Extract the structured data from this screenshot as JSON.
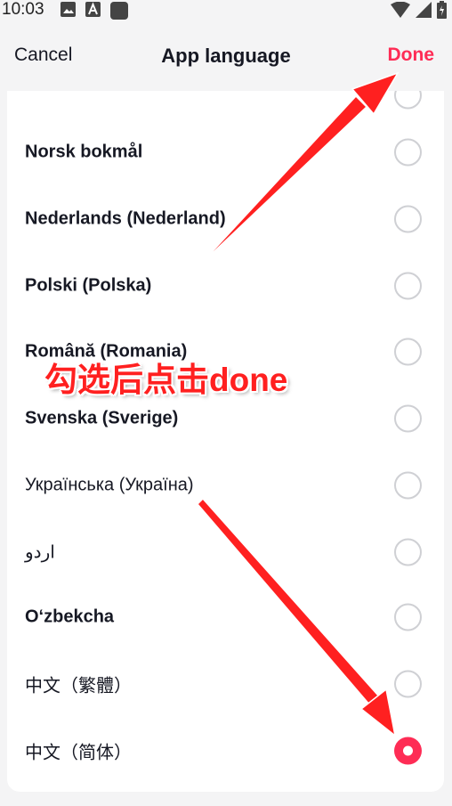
{
  "status_bar": {
    "time": "10:03",
    "left_icons": [
      "image-icon",
      "text-a-icon",
      "app-icon"
    ],
    "right_icons": [
      "wifi-icon",
      "signal-icon",
      "battery-icon"
    ]
  },
  "nav": {
    "cancel_label": "Cancel",
    "title": "App language",
    "done_label": "Done"
  },
  "colors": {
    "accent": "#fe2c55",
    "annotation": "#ff2020",
    "radio_border": "#cfd0d4",
    "background": "#f4f4f5"
  },
  "languages": [
    {
      "label": "Norsk bokmål",
      "selected": false
    },
    {
      "label": "Nederlands (Nederland)",
      "selected": false
    },
    {
      "label": "Polski (Polska)",
      "selected": false
    },
    {
      "label": "Română (Romania)",
      "selected": false
    },
    {
      "label": "Svenska (Sverige)",
      "selected": false
    },
    {
      "label": "Українська (Україна)",
      "selected": false
    },
    {
      "label": "اردو",
      "selected": false
    },
    {
      "label": "O‘zbekcha",
      "selected": false
    },
    {
      "label": "中文（繁體）",
      "selected": false
    },
    {
      "label": "中文（简体）",
      "selected": true
    }
  ],
  "annotation": {
    "text": "勾选后点击done"
  }
}
